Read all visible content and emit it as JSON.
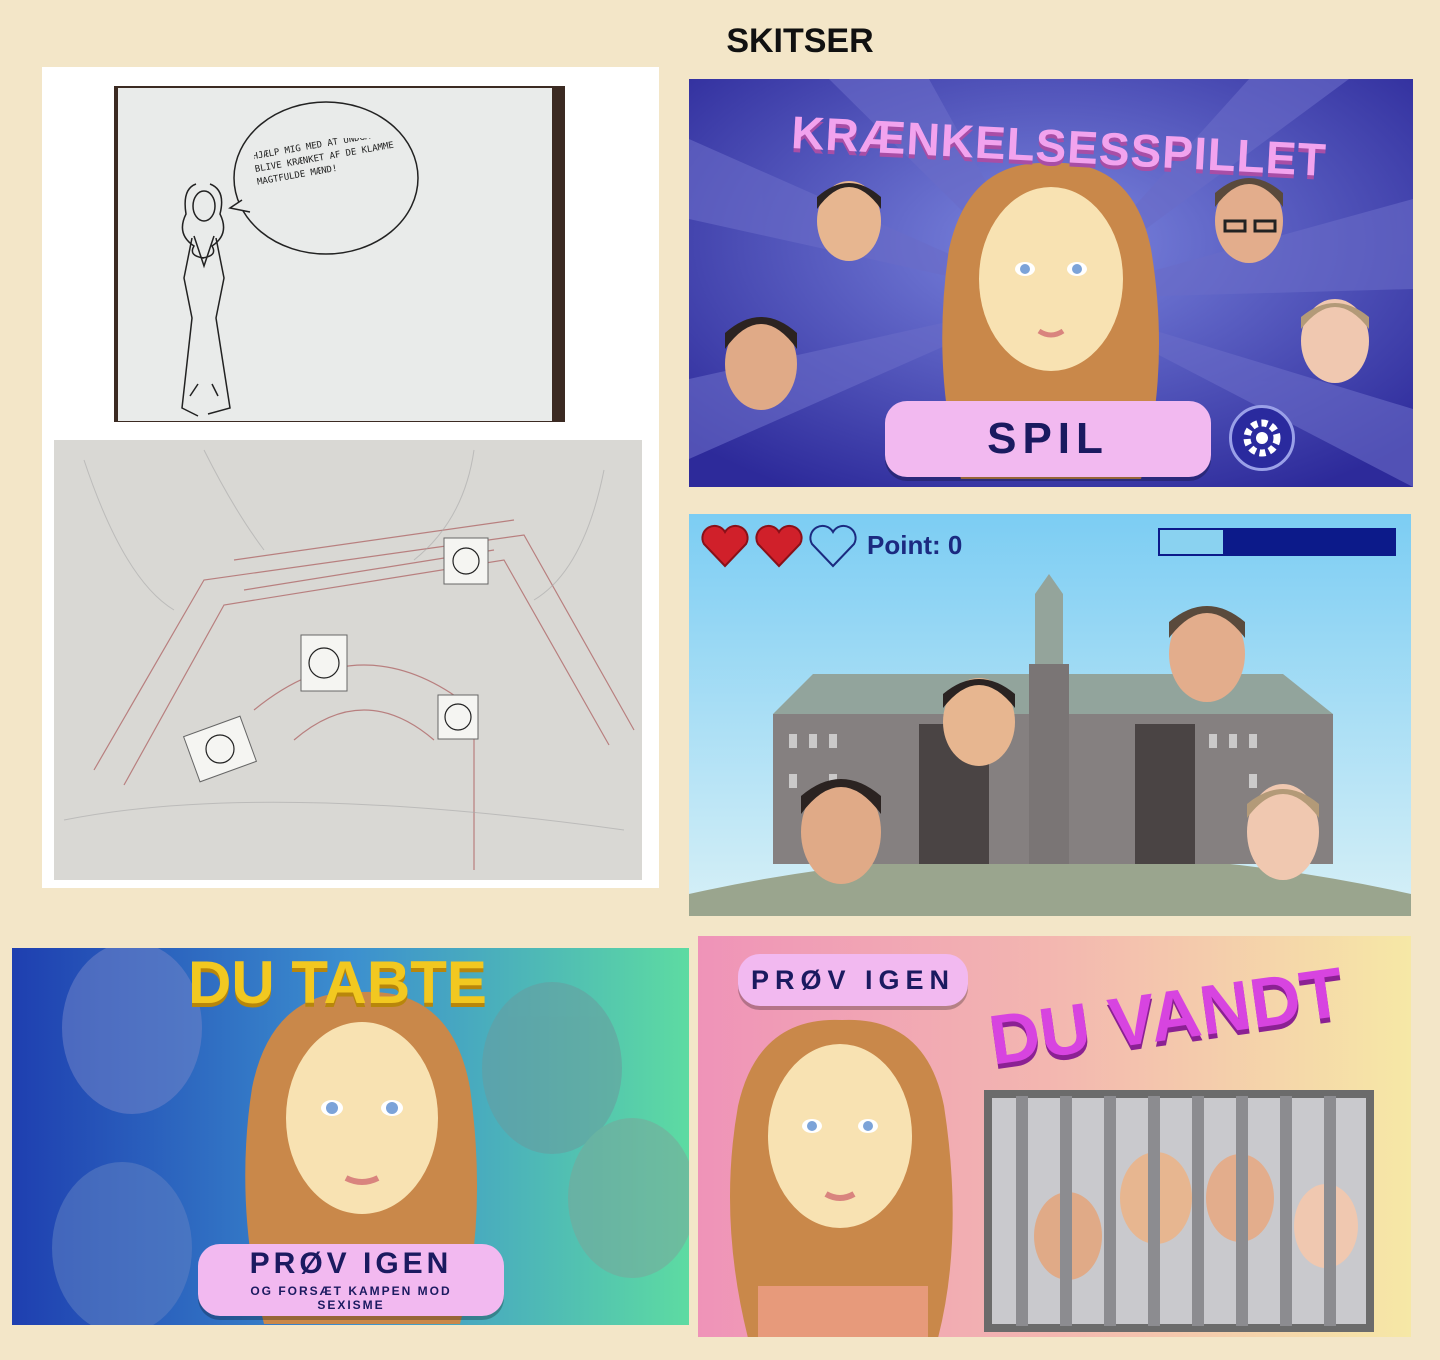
{
  "page_title": "SKITSER",
  "sketch_speech": "HJÆLP MIG MED AT UNDGÅ AT BLIVE KRÆNKET AF DE KLAMME MAGTFULDE MÆND!",
  "title_screen": {
    "game_title": "KRÆNKELSESSPILLET",
    "play_label": "SPIL",
    "settings_icon": "gear-icon"
  },
  "game_screen": {
    "hearts_filled": 2,
    "hearts_total": 3,
    "score_text": "Point: 0",
    "progress_fraction": 0.27
  },
  "lose_screen": {
    "heading": "DU TABTE",
    "retry_label": "PRØV IGEN",
    "retry_sub": "OG FORSÆT KAMPEN MOD SEXISME"
  },
  "win_screen": {
    "retry_label": "PRØV IGEN",
    "heading": "DU VANDT"
  },
  "colors": {
    "background": "#f3e6c8",
    "pill": "#f2b9f0",
    "navy": "#1b1a60",
    "heart": "#d0202a",
    "lose_heading": "#f2c820",
    "win_heading": "#d744e0"
  }
}
